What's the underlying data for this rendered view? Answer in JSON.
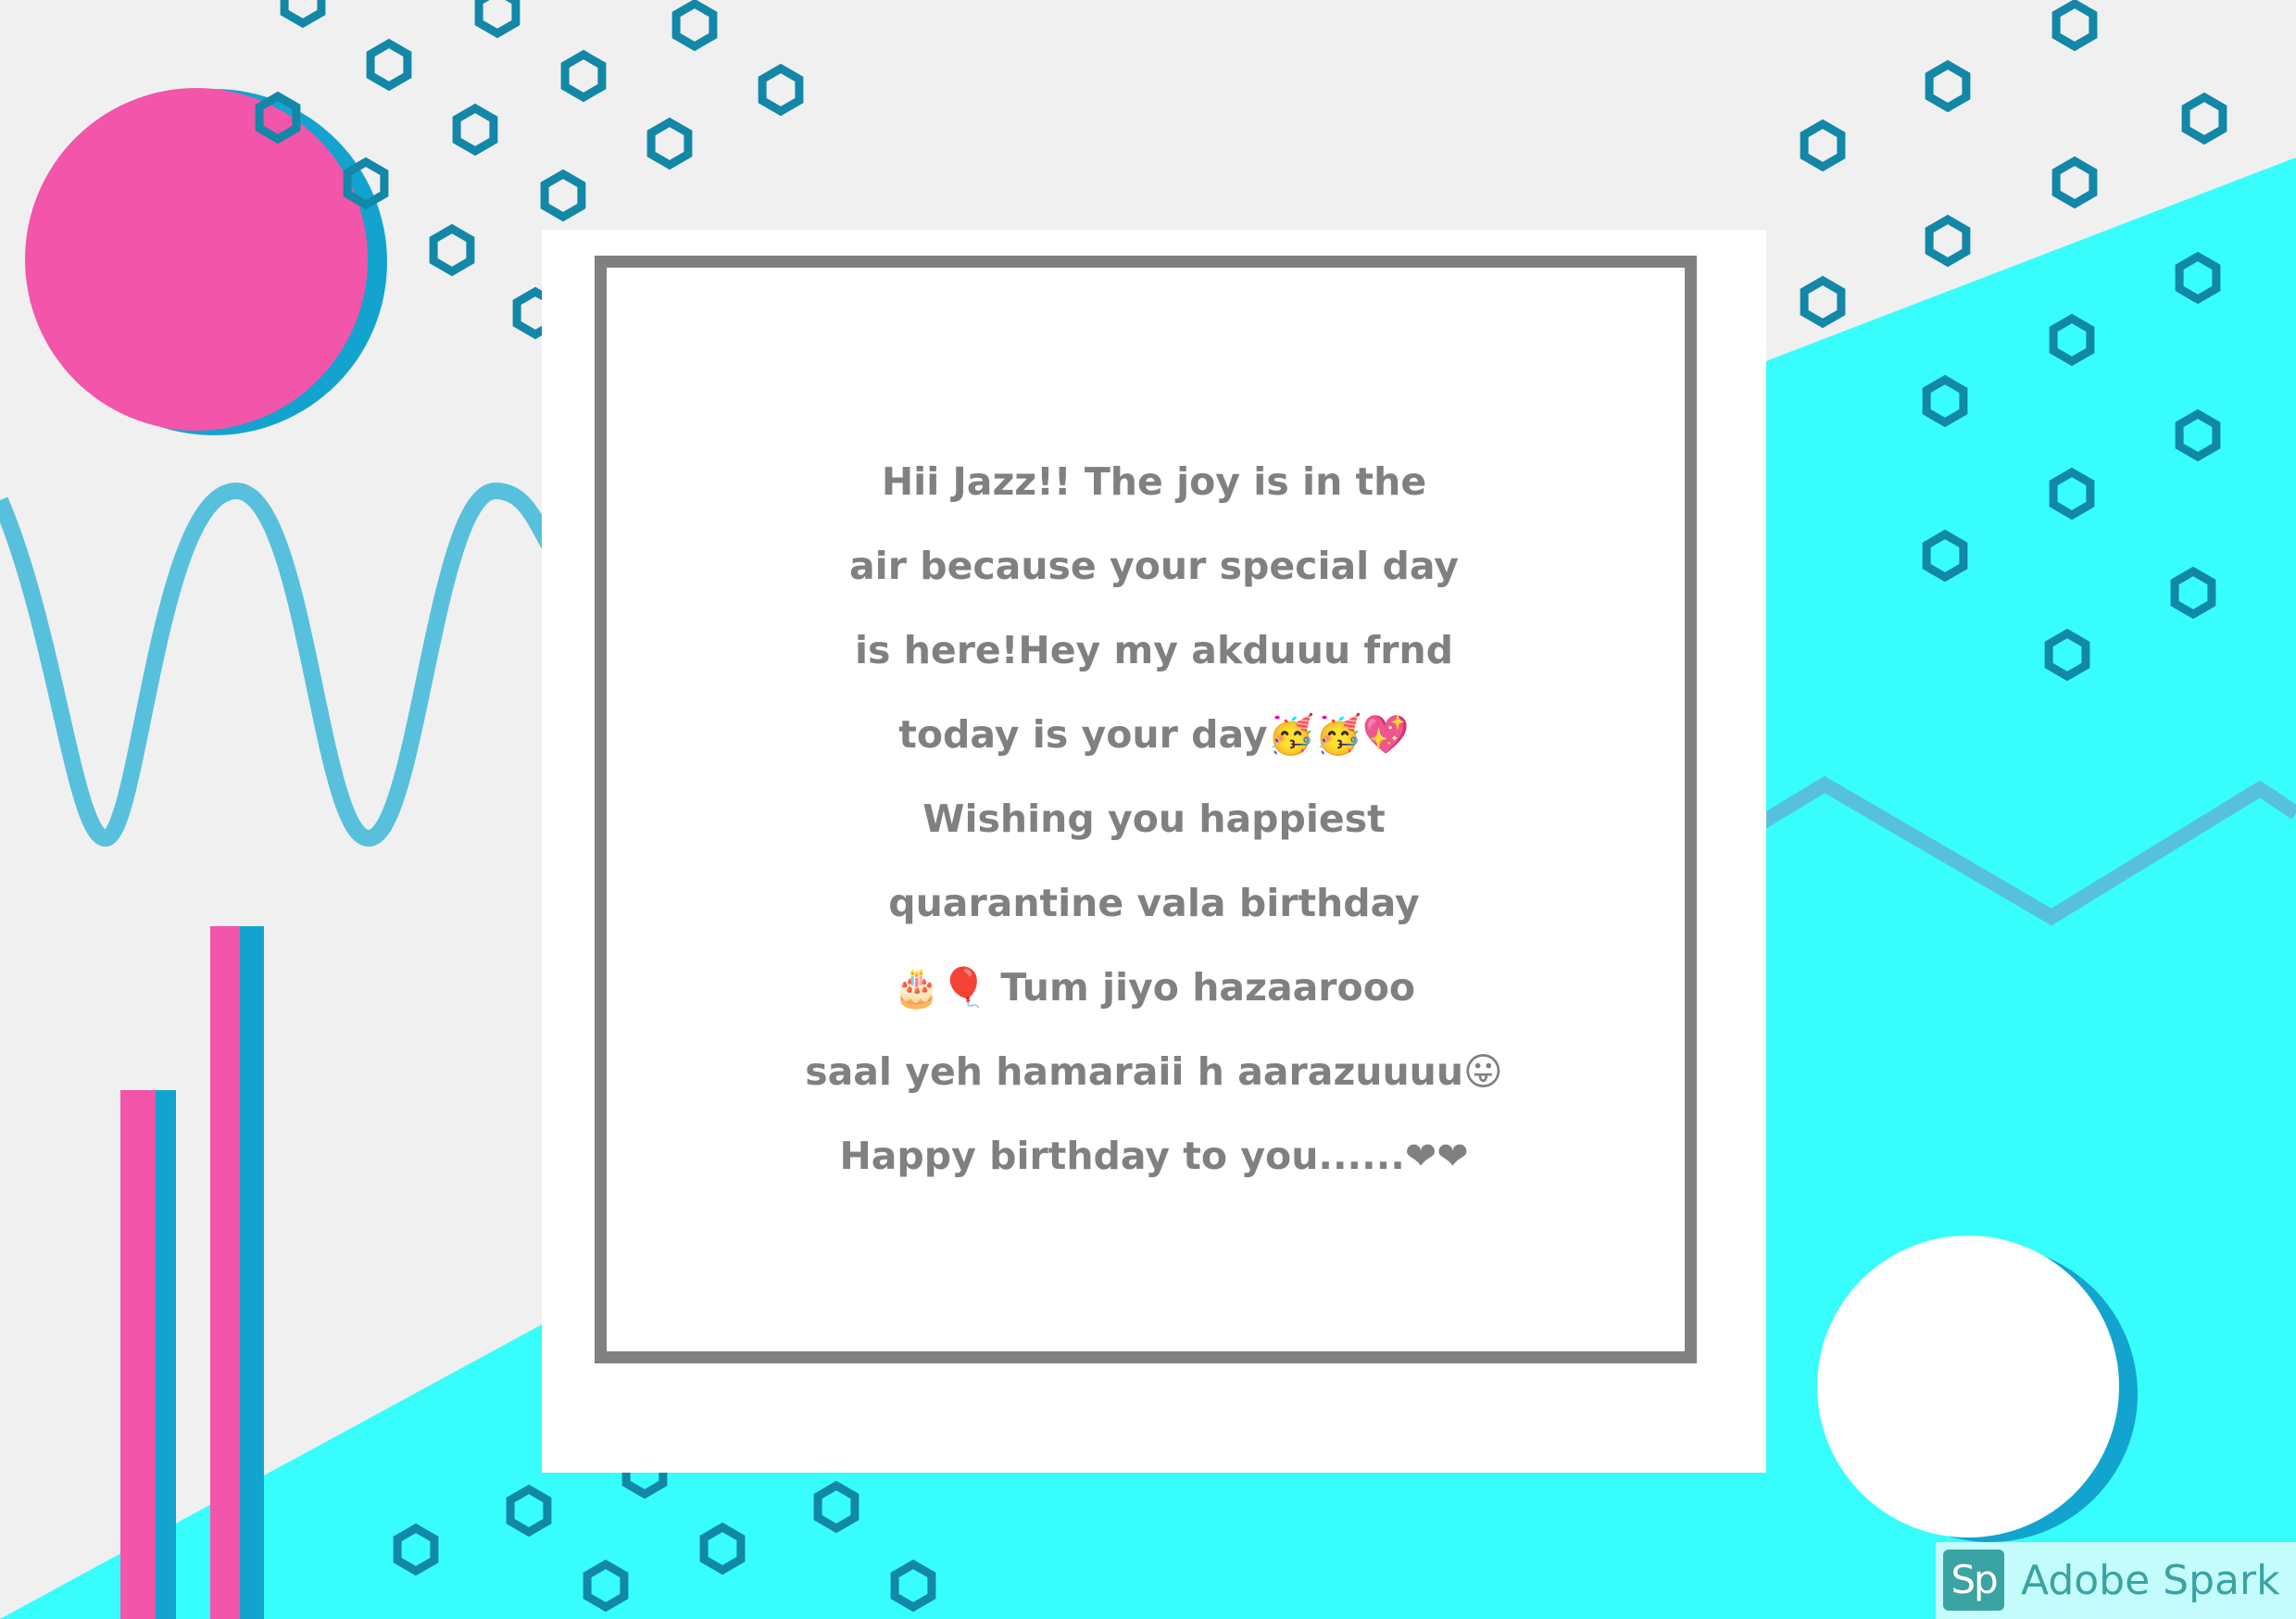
{
  "card": {
    "lines": [
      "Hii Jazz!! The joy is in the",
      "air because your special day",
      "is here!Hey my akduuu frnd",
      "today is your day🥳🥳💖",
      "Wishing you happiest",
      "quarantine vala birthday",
      "🎂🎈 Tum jiyo hazaarooo",
      "saal yeh hamaraii h aarazuuuu😛",
      "Happy birthday to you......❤❤"
    ]
  },
  "badge": {
    "logo": "Sp",
    "text": "Adobe Spark"
  },
  "colors": {
    "background": "#f0f0f0",
    "cyan": "#38fdfd",
    "pink": "#f255a9",
    "blue": "#12a4cf",
    "wave": "#57c1dd",
    "hexagon": "#1287a8",
    "frame": "#808080",
    "text": "#808080"
  },
  "icons": [
    "hexagon-icon",
    "adobe-spark-logo-icon"
  ]
}
